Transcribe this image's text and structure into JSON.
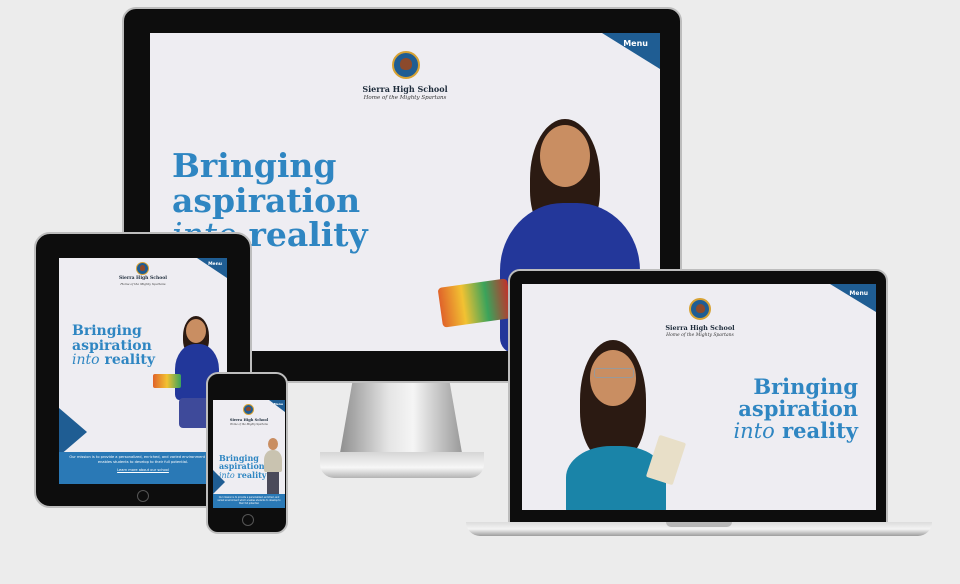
{
  "site": {
    "school_name": "Sierra High School",
    "motto": "Home of the Mighty Spartans",
    "menu_label": "Menu",
    "hero_line1": "Bringing",
    "hero_line2": "aspiration",
    "hero_into": "into",
    "hero_reality": "reality",
    "mission": "Our mission is to provide a personalized, enriched, and varied environment which enables students to develop to their full potential.",
    "learn_more": "Learn more about our school"
  },
  "colors": {
    "accent": "#2f86c2",
    "menu": "#1f5d93",
    "band": "#2a79b6"
  }
}
